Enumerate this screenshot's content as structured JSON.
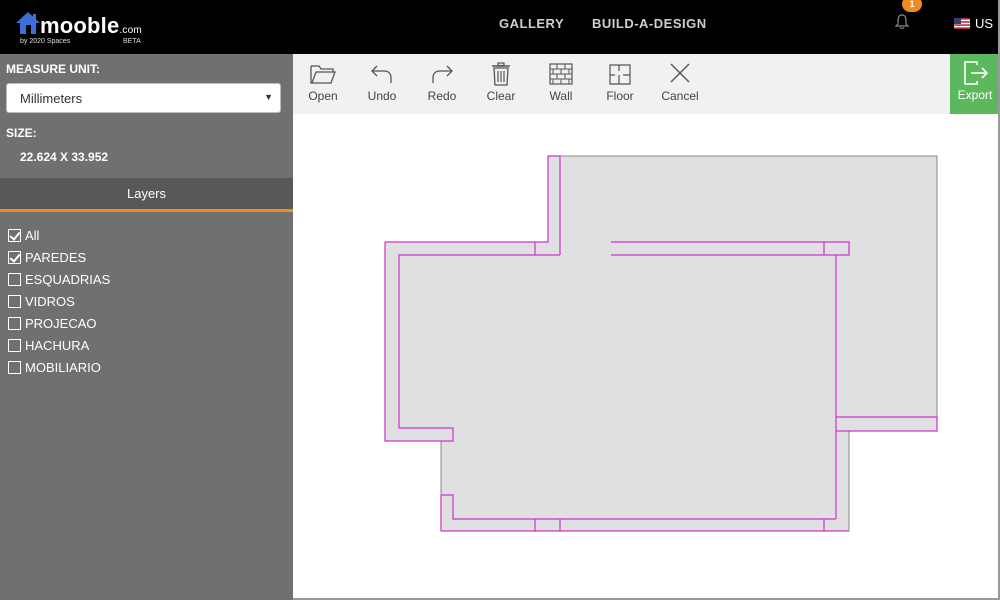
{
  "header": {
    "logo": {
      "name": "mooble",
      "suffix": ".com",
      "byline": "by 2020 Spaces",
      "beta": "BETA"
    },
    "nav": [
      "GALLERY",
      "BUILD-A-DESIGN"
    ],
    "notification_count": "1",
    "language": "US",
    "colors": {
      "background": "#000000",
      "badge": "#f08a24",
      "logo_accent": "#3b6fd3"
    }
  },
  "sidebar": {
    "measure_unit_label": "MEASURE UNIT:",
    "measure_unit_value": "Millimeters",
    "size_label": "SIZE:",
    "size_value": "22.624 X 33.952",
    "layers_title": "Layers",
    "layers": [
      {
        "label": "All",
        "checked": true
      },
      {
        "label": "PAREDES",
        "checked": true
      },
      {
        "label": "ESQUADRIAS",
        "checked": false
      },
      {
        "label": "VIDROS",
        "checked": false
      },
      {
        "label": "PROJECAO",
        "checked": false
      },
      {
        "label": "HACHURA",
        "checked": false
      },
      {
        "label": "MOBILIARIO",
        "checked": false
      }
    ],
    "colors": {
      "background": "#707070",
      "accent": "#f08a24"
    }
  },
  "toolbar": {
    "tools": [
      {
        "label": "Open",
        "icon": "folder-open-icon"
      },
      {
        "label": "Undo",
        "icon": "undo-icon"
      },
      {
        "label": "Redo",
        "icon": "redo-icon"
      },
      {
        "label": "Clear",
        "icon": "trash-icon"
      },
      {
        "label": "Wall",
        "icon": "brick-wall-icon"
      },
      {
        "label": "Floor",
        "icon": "floor-plan-icon"
      },
      {
        "label": "Cancel",
        "icon": "close-icon"
      }
    ],
    "export_label": "Export",
    "export_icon": "export-icon",
    "colors": {
      "export": "#5cb85c"
    }
  },
  "canvas": {
    "colors": {
      "floor_fill": "#e0e0e0",
      "outline": "#888888",
      "walls": "#cc33cc"
    }
  }
}
